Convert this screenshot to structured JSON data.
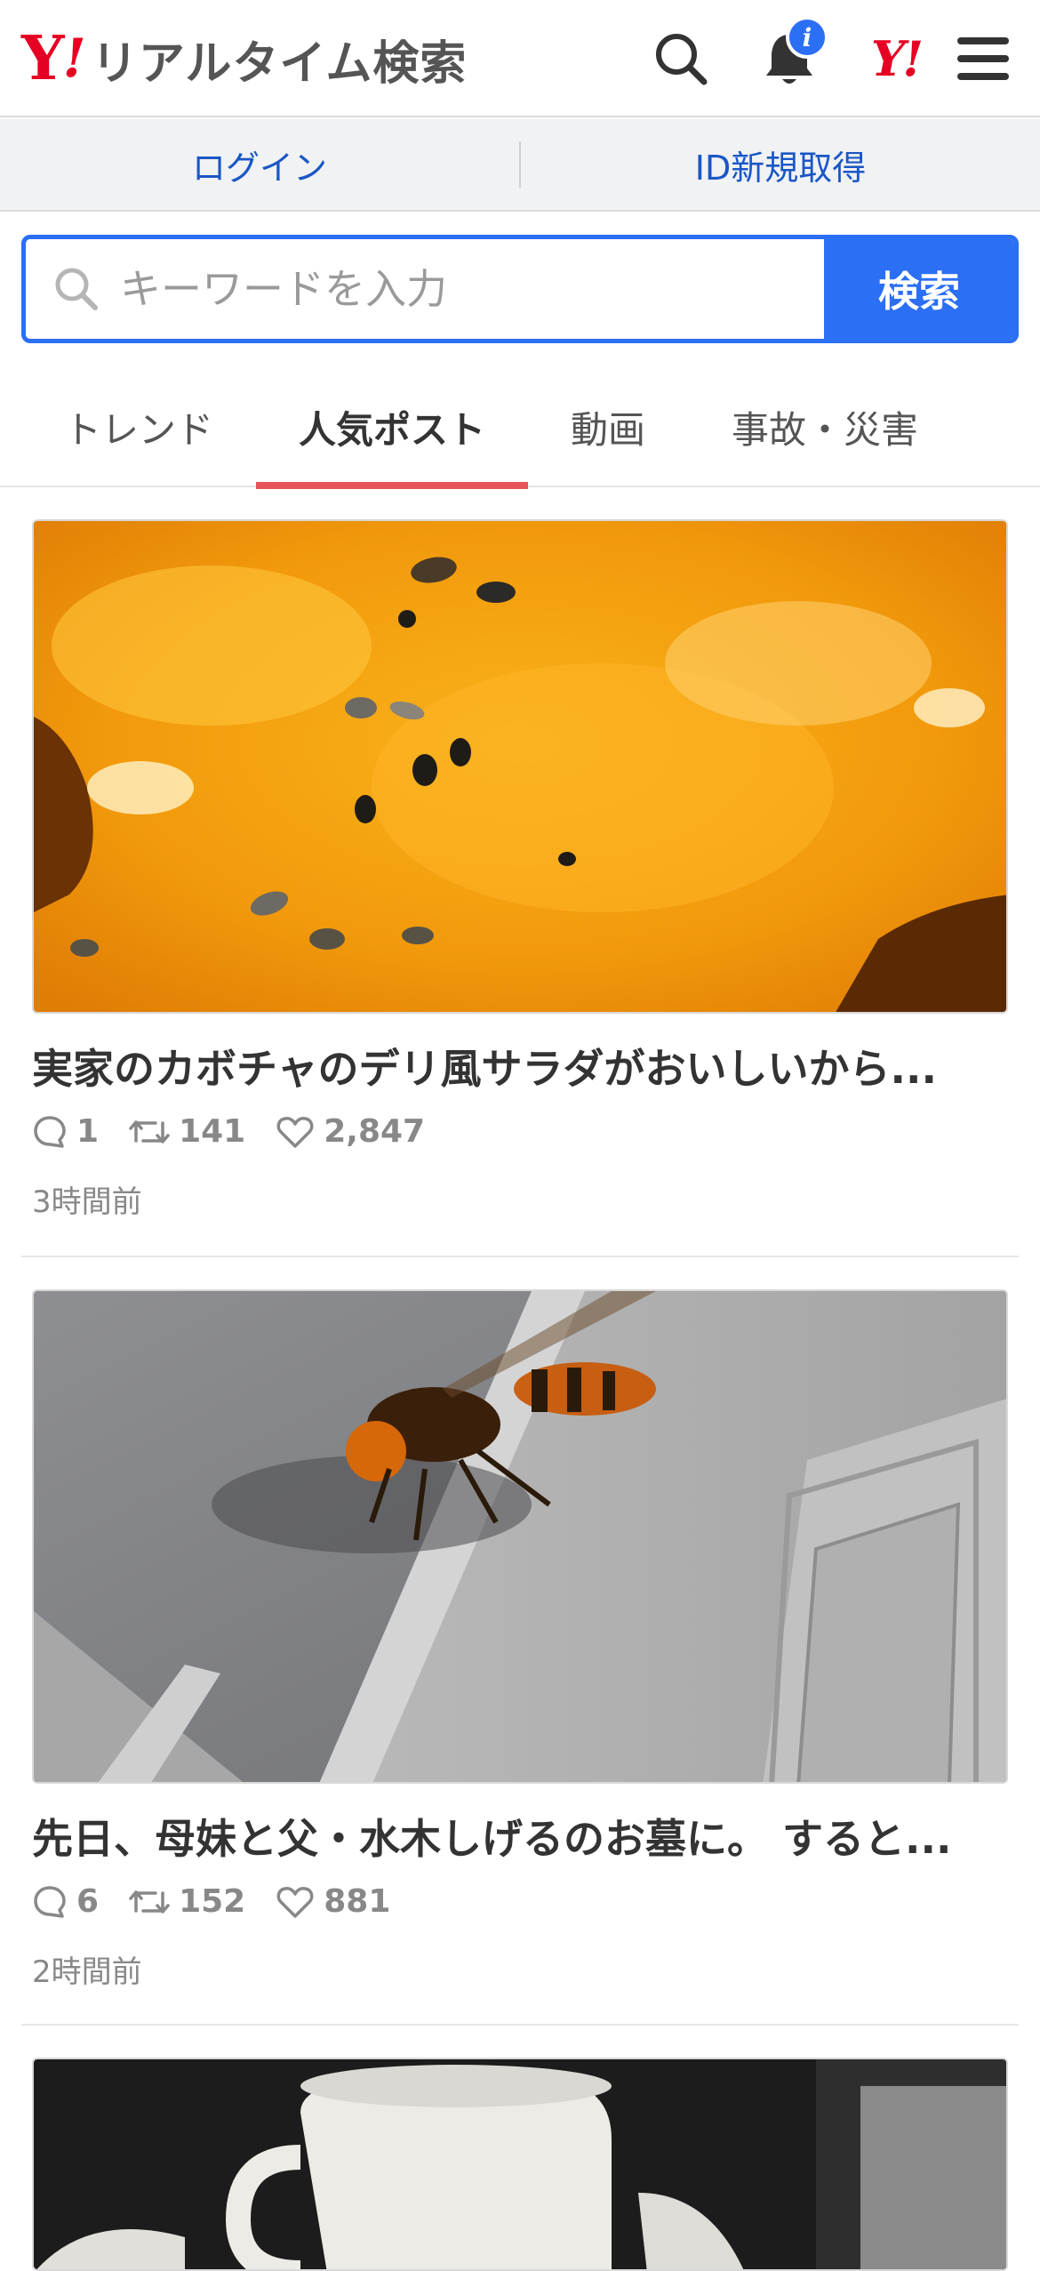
{
  "header": {
    "logo_mark": "Y",
    "logo_exclaim": "!",
    "logo_text": "リアルタイム検索",
    "notification_badge": "i",
    "yahoo_mark": "Y!"
  },
  "login_bar": {
    "login_label": "ログイン",
    "register_label": "ID新規取得"
  },
  "search": {
    "placeholder": "キーワードを入力",
    "button_label": "検索"
  },
  "tabs": [
    {
      "label": "トレンド",
      "active": false
    },
    {
      "label": "人気ポスト",
      "active": true
    },
    {
      "label": "動画",
      "active": false
    },
    {
      "label": "事故・災害",
      "active": false
    }
  ],
  "posts": [
    {
      "title": "実家のカボチャのデリ風サラダがおいしいから...",
      "replies": "1",
      "reposts": "141",
      "likes": "2,847",
      "time": "3時間前"
    },
    {
      "title": "先日、母妹と父・水木しげるのお墓に。 すると...",
      "replies": "6",
      "reposts": "152",
      "likes": "881",
      "time": "2時間前"
    }
  ],
  "colors": {
    "brand_red": "#e60023",
    "accent_blue": "#2b6ff5",
    "link_blue": "#1a57c6",
    "tab_underline": "#e5555a"
  }
}
